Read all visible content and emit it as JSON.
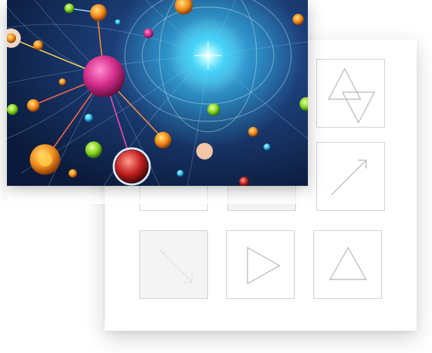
{
  "illustration": {
    "subject": "neural-network",
    "icon": "neural-network-illustration"
  },
  "icon_grid": {
    "tiles": [
      {
        "icon": "hidden-tile-1"
      },
      {
        "icon": "hidden-tile-2"
      },
      {
        "icon": "hourglass-triangles-icon"
      },
      {
        "icon": "hidden-tile-4"
      },
      {
        "icon": "hidden-tile-5"
      },
      {
        "icon": "arrow-up-right-icon"
      },
      {
        "icon": "arrow-down-right-icon"
      },
      {
        "icon": "play-triangle-icon"
      },
      {
        "icon": "triangle-up-icon"
      }
    ]
  },
  "colors": {
    "card_background": "#ffffff",
    "tile_border": "#cfcfcf",
    "icon_stroke": "#bdbdbd",
    "photo_glow": "#38d9ff",
    "photo_node_magenta": "#d62f8c"
  }
}
